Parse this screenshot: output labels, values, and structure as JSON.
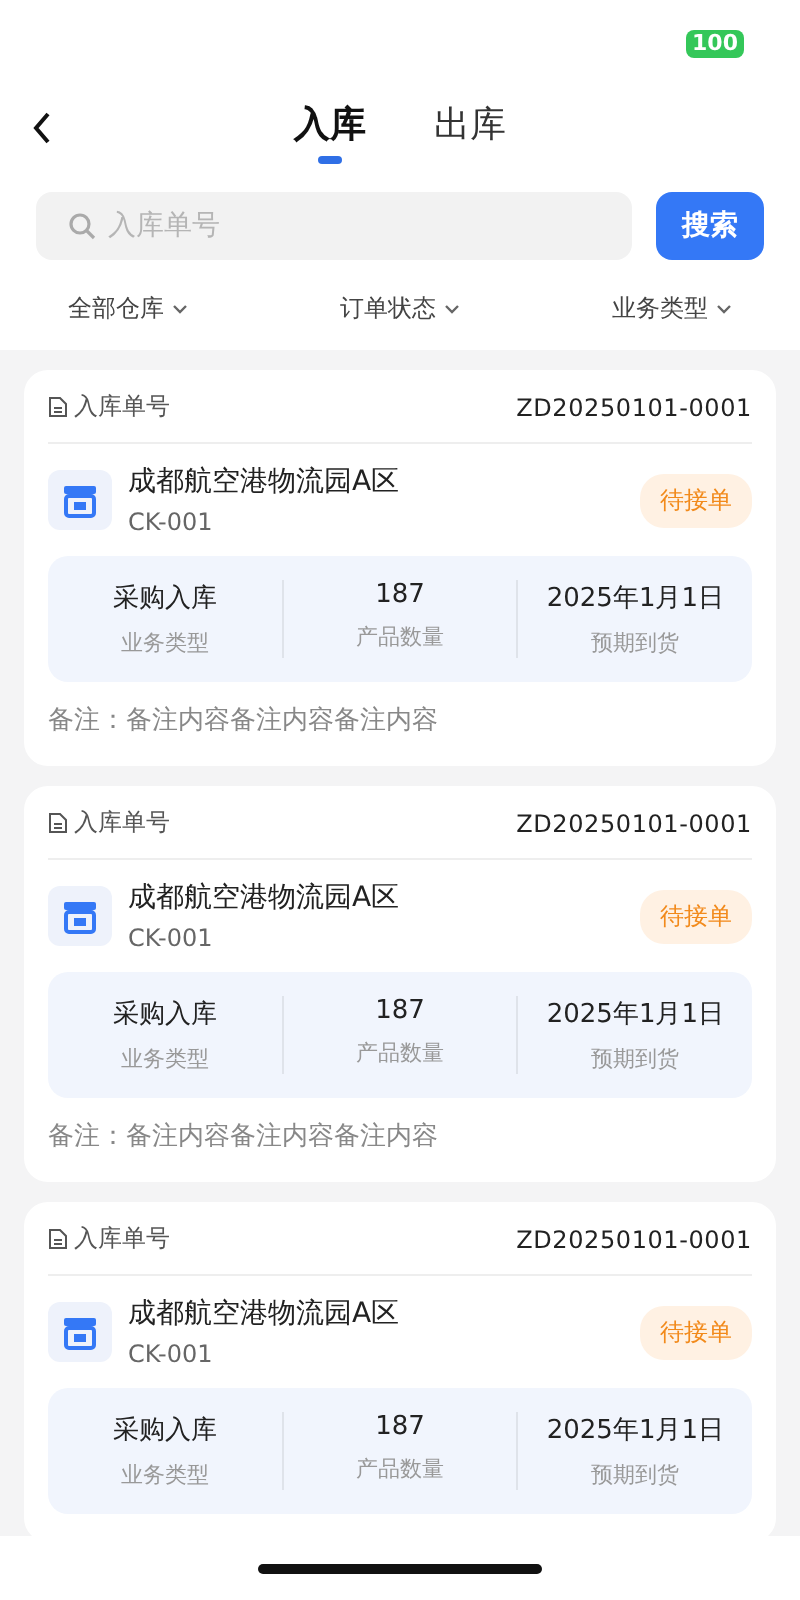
{
  "status_bar": {
    "battery": "100"
  },
  "tabs": [
    {
      "label": "入库",
      "selected": true
    },
    {
      "label": "出库",
      "selected": false
    }
  ],
  "search": {
    "placeholder": "入库单号",
    "button": "搜索"
  },
  "filters": [
    "全部仓库",
    "订单状态",
    "业务类型"
  ],
  "orders": [
    {
      "number_label": "入库单号",
      "number": "ZD20250101-0001",
      "warehouse": "成都航空港物流园A区",
      "code": "CK-001",
      "status": "待接单",
      "stats": [
        {
          "value": "采购入库",
          "label": "业务类型"
        },
        {
          "value": "187",
          "label": "产品数量"
        },
        {
          "value": "2025年1月1日",
          "label": "预期到货"
        }
      ],
      "remark": "备注：备注内容备注内容备注内容"
    },
    {
      "number_label": "入库单号",
      "number": "ZD20250101-0001",
      "warehouse": "成都航空港物流园A区",
      "code": "CK-001",
      "status": "待接单",
      "stats": [
        {
          "value": "采购入库",
          "label": "业务类型"
        },
        {
          "value": "187",
          "label": "产品数量"
        },
        {
          "value": "2025年1月1日",
          "label": "预期到货"
        }
      ],
      "remark": "备注：备注内容备注内容备注内容"
    },
    {
      "number_label": "入库单号",
      "number": "ZD20250101-0001",
      "warehouse": "成都航空港物流园A区",
      "code": "CK-001",
      "status": "待接单",
      "stats": [
        {
          "value": "采购入库",
          "label": "业务类型"
        },
        {
          "value": "187",
          "label": "产品数量"
        },
        {
          "value": "2025年1月1日",
          "label": "预期到货"
        }
      ]
    }
  ]
}
